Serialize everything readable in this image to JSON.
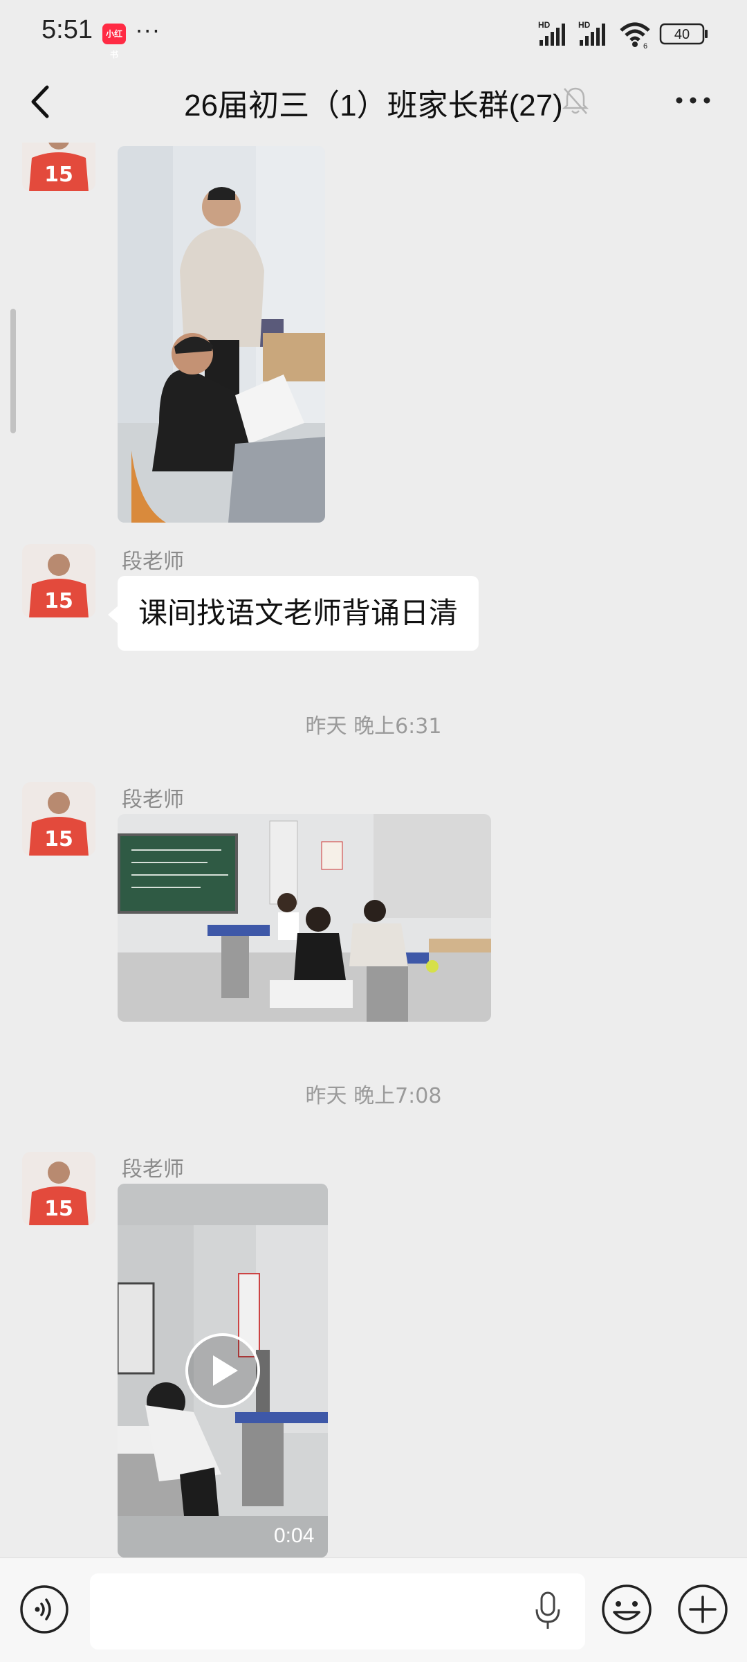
{
  "status_bar": {
    "time": "5:51",
    "notification_app_label": "小红书",
    "more": "···",
    "signal_1_label": "HD",
    "signal_2_label": "HD",
    "wifi_sub": "6",
    "battery": "40"
  },
  "header": {
    "title": "26届初三（1）班家长群(27)",
    "icons": [
      "back-icon",
      "mute-bell-icon",
      "more-icon"
    ]
  },
  "messages": [
    {
      "type": "image",
      "sender": "",
      "orientation": "portrait"
    },
    {
      "type": "text",
      "sender": "段老师",
      "text": "课间找语文老师背诵日清"
    },
    {
      "type": "timestamp",
      "text": "昨天 晚上6:31"
    },
    {
      "type": "image",
      "sender": "段老师",
      "orientation": "landscape"
    },
    {
      "type": "timestamp",
      "text": "昨天 晚上7:08"
    },
    {
      "type": "video",
      "sender": "段老师",
      "duration": "0:04"
    }
  ],
  "avatar_number": "15",
  "input_bar": {
    "placeholder": "",
    "icons": [
      "voice-icon",
      "mic-icon",
      "emoji-icon",
      "plus-icon"
    ]
  },
  "colors": {
    "background": "#ededed",
    "bubble": "#ffffff",
    "jersey_red": "#e34a3c",
    "notif_red": "#ff2b44"
  }
}
